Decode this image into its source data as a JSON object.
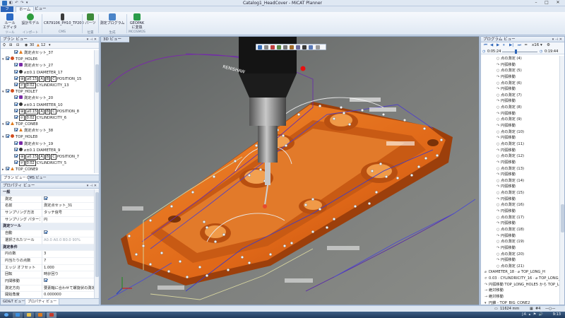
{
  "window": {
    "title": "Catalog1_HeadCover - MiCAT Planner",
    "qat_icons": "◧ ↶ ↷ ▾"
  },
  "ribbon": {
    "tabs": [
      "ファイル",
      "ホーム",
      "ビュー"
    ],
    "buttons": [
      {
        "label": "ルール\nエディタ",
        "icon": "ruler-icon",
        "color": "#2d6bc4"
      },
      {
        "label": "設計モデル",
        "icon": "add-model-icon",
        "color": "#2e9c3e"
      },
      {
        "label": "CR79106_PH10_TP200",
        "icon": "probe-icon",
        "color": "#3b3b3b"
      },
      {
        "label": "パーツ",
        "icon": "parts-icon",
        "color": "#3d8a3a"
      },
      {
        "label": "測定プログラム",
        "icon": "program-icon",
        "color": "#4a84c8"
      },
      {
        "label": "GEOPAK\nに変換",
        "icon": "convert-icon",
        "color": "#2a9c4a"
      }
    ],
    "groups": [
      "ツール",
      "インポート",
      "CMS",
      "位置",
      "生成",
      "MCOSMOS"
    ]
  },
  "plan": {
    "title": "プラン ビュー",
    "toolbar": {
      "count_a": "30",
      "count_b": "12"
    },
    "rows": [
      {
        "indent": 14,
        "exp": "",
        "icon": "warn",
        "text": "測定点セット_37"
      },
      {
        "indent": 2,
        "exp": "▾",
        "icon": "cyl",
        "text": "TOP_HOLE6"
      },
      {
        "indent": 14,
        "exp": "",
        "icon": "probe",
        "text": "測定点セット_27"
      },
      {
        "indent": 14,
        "exp": "",
        "icon": "diam",
        "text": "⌀±0.1 DIAMETER_17"
      },
      {
        "indent": 14,
        "exp": "",
        "icon": "",
        "fcf": [
          "⊕",
          "⌀0.15",
          "A",
          "B",
          "C"
        ],
        "text": "POSITION_15"
      },
      {
        "indent": 14,
        "exp": "",
        "icon": "",
        "fcf": [
          "⌭",
          "0.02"
        ],
        "text": "CYLINDRICITY_13"
      },
      {
        "indent": 2,
        "exp": "▾",
        "icon": "cyl",
        "text": "TOP_HOLE7"
      },
      {
        "indent": 14,
        "exp": "",
        "icon": "probe",
        "text": "測定点セット_20"
      },
      {
        "indent": 14,
        "exp": "",
        "icon": "diam",
        "text": "⌀±0.1 DIAMETER_10"
      },
      {
        "indent": 14,
        "exp": "",
        "icon": "",
        "fcf": [
          "⊕",
          "⌀0.15",
          "A",
          "B",
          "C"
        ],
        "text": "POSITION_8"
      },
      {
        "indent": 14,
        "exp": "",
        "icon": "",
        "fcf": [
          "⌭",
          "0.02"
        ],
        "text": "CYLINDRICITY_6"
      },
      {
        "indent": 2,
        "exp": "▾",
        "icon": "warn",
        "text": "TOP_CONE8"
      },
      {
        "indent": 14,
        "exp": "",
        "icon": "warn",
        "text": "測定点セット_38"
      },
      {
        "indent": 2,
        "exp": "▾",
        "icon": "cyl",
        "text": "TOP_HOLE8"
      },
      {
        "indent": 14,
        "exp": "",
        "icon": "probe",
        "text": "測定点セット_19"
      },
      {
        "indent": 14,
        "exp": "",
        "icon": "diam",
        "text": "⌀±0.1 DIAMETER_9"
      },
      {
        "indent": 14,
        "exp": "",
        "icon": "",
        "fcf": [
          "⊕",
          "⌀0.15",
          "A",
          "B",
          "C"
        ],
        "text": "POSITION_7"
      },
      {
        "indent": 14,
        "exp": "",
        "icon": "",
        "fcf": [
          "⌭",
          "0.02"
        ],
        "text": "CYLINDRICITY_5"
      },
      {
        "indent": 2,
        "exp": "▸",
        "icon": "warn",
        "text": "TOP_CONE9"
      }
    ],
    "tabs": [
      "プラン ビュー",
      "CMS ビュー"
    ]
  },
  "properties": {
    "title": "プロパティ ビュー",
    "rows": [
      {
        "type": "cat",
        "label": "一般"
      },
      {
        "type": "check",
        "label": "測定",
        "on": true
      },
      {
        "type": "text",
        "label": "名前",
        "value": "測定点セット_31"
      },
      {
        "type": "text",
        "label": "サンプリング方法",
        "value": "タッチ信号"
      },
      {
        "type": "text",
        "label": "サンプリング パターン",
        "value": "円"
      },
      {
        "type": "cat",
        "label": "測定ツール"
      },
      {
        "type": "check",
        "label": "自動",
        "on": true
      },
      {
        "type": "text",
        "label": "選択されたツール",
        "value": "A0.0   A0.0   B0.0   90%",
        "dim": true
      },
      {
        "type": "cat",
        "label": "測定条件"
      },
      {
        "type": "text",
        "label": "円の数",
        "value": "3"
      },
      {
        "type": "text",
        "label": "円当たりの点数",
        "value": "7"
      },
      {
        "type": "text",
        "label": "エッジ オフセット",
        "value": "1.000"
      },
      {
        "type": "text",
        "label": "回転",
        "value": "時計回り"
      },
      {
        "type": "check",
        "label": "円間移動",
        "on": true
      },
      {
        "type": "text",
        "label": "測定方向",
        "value": "要素軸に合わせて螺旋状の測定"
      },
      {
        "type": "text",
        "label": "開始角度",
        "value": "0.000000"
      }
    ],
    "tabs": [
      "GD&T ビュー",
      "プロパティ ビュー"
    ]
  },
  "view3d": {
    "title": "3D ビュー",
    "probe_brand": "RENISHAW"
  },
  "program": {
    "title": "プログラム ビュー",
    "speed": "x16",
    "time_start": "0:05:24",
    "time_end": "0:19:44",
    "rows": [
      {
        "indent": 22,
        "icon": "○",
        "text": "点の測定 (4)"
      },
      {
        "indent": 22,
        "icon": "↷",
        "text": "円弧移動"
      },
      {
        "indent": 22,
        "icon": "○",
        "text": "点の測定 (5)"
      },
      {
        "indent": 22,
        "icon": "↷",
        "text": "円弧移動"
      },
      {
        "indent": 22,
        "icon": "○",
        "text": "点の測定 (6)"
      },
      {
        "indent": 22,
        "icon": "↷",
        "text": "円弧移動"
      },
      {
        "indent": 22,
        "icon": "○",
        "text": "点の測定 (7)"
      },
      {
        "indent": 22,
        "icon": "↷",
        "text": "円弧移動"
      },
      {
        "indent": 22,
        "icon": "○",
        "text": "点の測定 (8)"
      },
      {
        "indent": 22,
        "icon": "↷",
        "text": "円弧移動"
      },
      {
        "indent": 22,
        "icon": "○",
        "text": "点の測定 (9)"
      },
      {
        "indent": 22,
        "icon": "↷",
        "text": "円弧移動"
      },
      {
        "indent": 22,
        "icon": "○",
        "text": "点の測定 (10)"
      },
      {
        "indent": 22,
        "icon": "↷",
        "text": "円弧移動"
      },
      {
        "indent": 22,
        "icon": "○",
        "text": "点の測定 (11)"
      },
      {
        "indent": 22,
        "icon": "↷",
        "text": "円弧移動"
      },
      {
        "indent": 22,
        "icon": "○",
        "text": "点の測定 (12)"
      },
      {
        "indent": 22,
        "icon": "↷",
        "text": "円弧移動"
      },
      {
        "indent": 22,
        "icon": "○",
        "text": "点の測定 (13)"
      },
      {
        "indent": 22,
        "icon": "↷",
        "text": "円弧移動"
      },
      {
        "indent": 22,
        "icon": "○",
        "text": "点の測定 (14)"
      },
      {
        "indent": 22,
        "icon": "↷",
        "text": "円弧移動"
      },
      {
        "indent": 22,
        "icon": "○",
        "text": "点の測定 (15)"
      },
      {
        "indent": 22,
        "icon": "↷",
        "text": "円弧移動"
      },
      {
        "indent": 22,
        "icon": "○",
        "text": "点の測定 (16)"
      },
      {
        "indent": 22,
        "icon": "↷",
        "text": "円弧移動"
      },
      {
        "indent": 22,
        "icon": "○",
        "text": "点の測定 (17)"
      },
      {
        "indent": 22,
        "icon": "↷",
        "text": "円弧移動"
      },
      {
        "indent": 22,
        "icon": "○",
        "text": "点の測定 (18)"
      },
      {
        "indent": 22,
        "icon": "↷",
        "text": "円弧移動"
      },
      {
        "indent": 22,
        "icon": "○",
        "text": "点の測定 (19)"
      },
      {
        "indent": 22,
        "icon": "↷",
        "text": "円弧移動"
      },
      {
        "indent": 22,
        "icon": "○",
        "text": "点の測定 (20)"
      },
      {
        "indent": 22,
        "icon": "↷",
        "text": "円弧移動"
      },
      {
        "indent": 22,
        "icon": "○",
        "text": "点の測定 (21)"
      },
      {
        "indent": 5,
        "icon": "⌀",
        "text": "DIAMETER_18 · ⌀ TOP_LONG_H"
      },
      {
        "indent": 5,
        "icon": "⌭",
        "text": "0.03 · CYLINDRICITY_16 · ⌀ TOP_LONG_"
      },
      {
        "indent": 5,
        "icon": "↷",
        "text": "円弧移動 TOP_LONG_HOLE5 から TOP_L"
      },
      {
        "indent": 5,
        "icon": "→",
        "text": "絶対移動"
      },
      {
        "indent": 5,
        "icon": "→",
        "text": "絶対移動"
      },
      {
        "indent": 5,
        "icon": "▾",
        "text": "円錐 - TOP_BIG_CONE2"
      },
      {
        "indent": 14,
        "icon": "•",
        "text": "測定点セット_31 - 円",
        "selected": true
      }
    ]
  },
  "status": {
    "coord": "11624 mm",
    "page": "#4"
  },
  "taskbar": {
    "clock": "9:13",
    "tray": "JA ▴ ⚑ 🔊",
    "apps": [
      {
        "name": "start-orb",
        "color": "#58a6f0"
      },
      {
        "name": "ie-icon",
        "color": "#3a8fe0"
      },
      {
        "name": "explorer-icon",
        "color": "#e8c14a"
      },
      {
        "name": "media-icon",
        "color": "#e07a1c"
      },
      {
        "name": "micat-icon",
        "color": "#c4392b"
      }
    ]
  }
}
